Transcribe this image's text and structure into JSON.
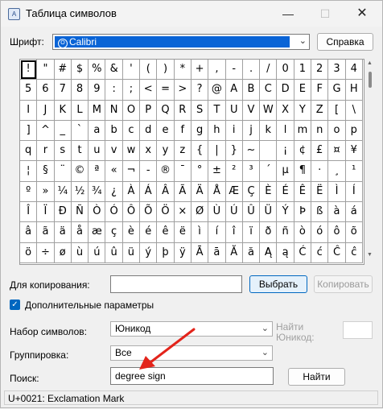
{
  "window": {
    "title": "Таблица символов"
  },
  "font": {
    "label": "Шрифт:",
    "selected": "Calibri",
    "help_button": "Справка",
    "font_icon": "font-icon"
  },
  "grid": {
    "selected_index": 0,
    "characters": [
      "!",
      "\"",
      "#",
      "$",
      "%",
      "&",
      "'",
      "(",
      ")",
      "*",
      "+",
      ",",
      "-",
      ".",
      "/",
      "0",
      "1",
      "2",
      "3",
      "4",
      "5",
      "6",
      "7",
      "8",
      "9",
      ":",
      ";",
      "<",
      "=",
      ">",
      "?",
      "@",
      "A",
      "B",
      "C",
      "D",
      "E",
      "F",
      "G",
      "H",
      "I",
      "J",
      "K",
      "L",
      "M",
      "N",
      "O",
      "P",
      "Q",
      "R",
      "S",
      "T",
      "U",
      "V",
      "W",
      "X",
      "Y",
      "Z",
      "[",
      "\\",
      "]",
      "^",
      "_",
      "`",
      "a",
      "b",
      "c",
      "d",
      "e",
      "f",
      "g",
      "h",
      "i",
      "j",
      "k",
      "l",
      "m",
      "n",
      "o",
      "p",
      "q",
      "r",
      "s",
      "t",
      "u",
      "v",
      "w",
      "x",
      "y",
      "z",
      "{",
      "|",
      "}",
      "~",
      " ",
      "¡",
      "¢",
      "£",
      "¤",
      "¥",
      "¦",
      "§",
      "¨",
      "©",
      "ª",
      "«",
      "¬",
      "-",
      "®",
      "¯",
      "°",
      "±",
      "²",
      "³",
      "´",
      "µ",
      "¶",
      "·",
      "¸",
      "¹",
      "º",
      "»",
      "¼",
      "½",
      "¾",
      "¿",
      "À",
      "Á",
      "Â",
      "Ã",
      "Ä",
      "Å",
      "Æ",
      "Ç",
      "È",
      "É",
      "Ê",
      "Ë",
      "Ì",
      "Í",
      "Î",
      "Ï",
      "Ð",
      "Ñ",
      "Ò",
      "Ó",
      "Ô",
      "Õ",
      "Ö",
      "×",
      "Ø",
      "Ù",
      "Ú",
      "Û",
      "Ü",
      "Ý",
      "Þ",
      "ß",
      "à",
      "á",
      "â",
      "ã",
      "ä",
      "å",
      "æ",
      "ç",
      "è",
      "é",
      "ê",
      "ë",
      "ì",
      "í",
      "î",
      "ï",
      "ð",
      "ñ",
      "ò",
      "ó",
      "ô",
      "õ",
      "ö",
      "÷",
      "ø",
      "ù",
      "ú",
      "û",
      "ü",
      "ý",
      "þ",
      "ÿ",
      "Ā",
      "ā",
      "Ă",
      "ă",
      "Ą",
      "ą",
      "Ć",
      "ć",
      "Ĉ",
      "ĉ"
    ]
  },
  "copy": {
    "label": "Для копирования:",
    "value": "",
    "select_button": "Выбрать",
    "copy_button": "Копировать"
  },
  "advanced": {
    "label": "Дополнительные параметры",
    "checked": true
  },
  "charset": {
    "label": "Набор символов:",
    "value": "Юникод",
    "goto_label_1": "Найти",
    "goto_label_2": "Юникод:",
    "goto_value": ""
  },
  "grouping": {
    "label": "Группировка:",
    "value": "Все"
  },
  "search": {
    "label": "Поиск:",
    "value": "degree sign",
    "button": "Найти"
  },
  "status": {
    "text": "U+0021: Exclamation Mark"
  },
  "annotation": {
    "color": "#e3241b"
  },
  "icons": {
    "minimize": "minimize-icon",
    "maximize": "maximize-icon",
    "close": "close-icon",
    "dropdown": "chevron-down-icon",
    "check": "check-icon"
  }
}
